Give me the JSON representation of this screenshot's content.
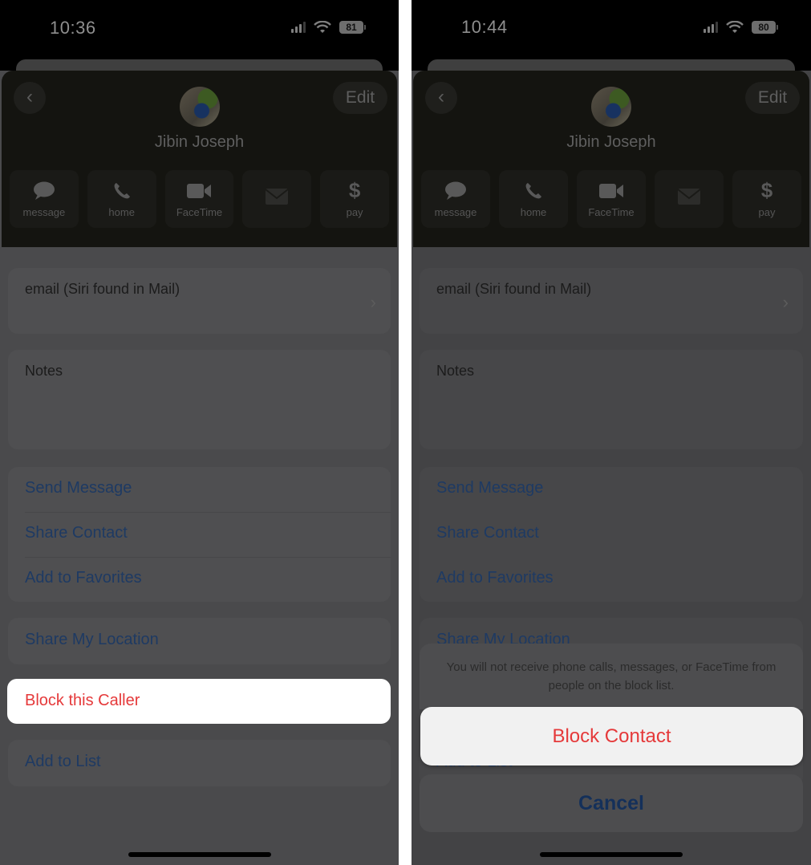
{
  "left": {
    "status": {
      "time": "10:36",
      "battery": "81"
    },
    "header": {
      "back_label": "<",
      "edit_label": "Edit",
      "contact_name": "Jibin Joseph",
      "actions": [
        {
          "icon": "message-icon",
          "label": "message",
          "enabled": true
        },
        {
          "icon": "phone-icon",
          "label": "home",
          "enabled": true
        },
        {
          "icon": "video-icon",
          "label": "FaceTime",
          "enabled": true
        },
        {
          "icon": "mail-icon",
          "label": "",
          "enabled": false
        },
        {
          "icon": "dollar-icon",
          "label": "pay",
          "enabled": true
        }
      ]
    },
    "email_field": "email (Siri found in Mail)",
    "notes_label": "Notes",
    "link_group": [
      "Send Message",
      "Share Contact",
      "Add to Favorites"
    ],
    "share_location": "Share My Location",
    "block_caller": "Block this Caller",
    "add_to_list": "Add to List"
  },
  "right": {
    "status": {
      "time": "10:44",
      "battery": "80"
    },
    "header": {
      "back_label": "<",
      "edit_label": "Edit",
      "contact_name": "Jibin Joseph",
      "actions": [
        {
          "icon": "message-icon",
          "label": "message",
          "enabled": true
        },
        {
          "icon": "phone-icon",
          "label": "home",
          "enabled": true
        },
        {
          "icon": "video-icon",
          "label": "FaceTime",
          "enabled": true
        },
        {
          "icon": "mail-icon",
          "label": "",
          "enabled": false
        },
        {
          "icon": "dollar-icon",
          "label": "pay",
          "enabled": true
        }
      ]
    },
    "email_field": "email (Siri found in Mail)",
    "notes_label": "Notes",
    "link_group": [
      "Send Message",
      "Share Contact",
      "Add to Favorites"
    ],
    "share_location": "Share My Location",
    "add_to_list": "Add to List",
    "action_sheet": {
      "message": "You will not receive phone calls, messages, or FaceTime from people on the block list.",
      "block_label": "Block Contact",
      "cancel_label": "Cancel"
    }
  },
  "colors": {
    "destructive": "#e5393a",
    "link": "#1e3a63",
    "highlight_bg": "#ffffff"
  }
}
